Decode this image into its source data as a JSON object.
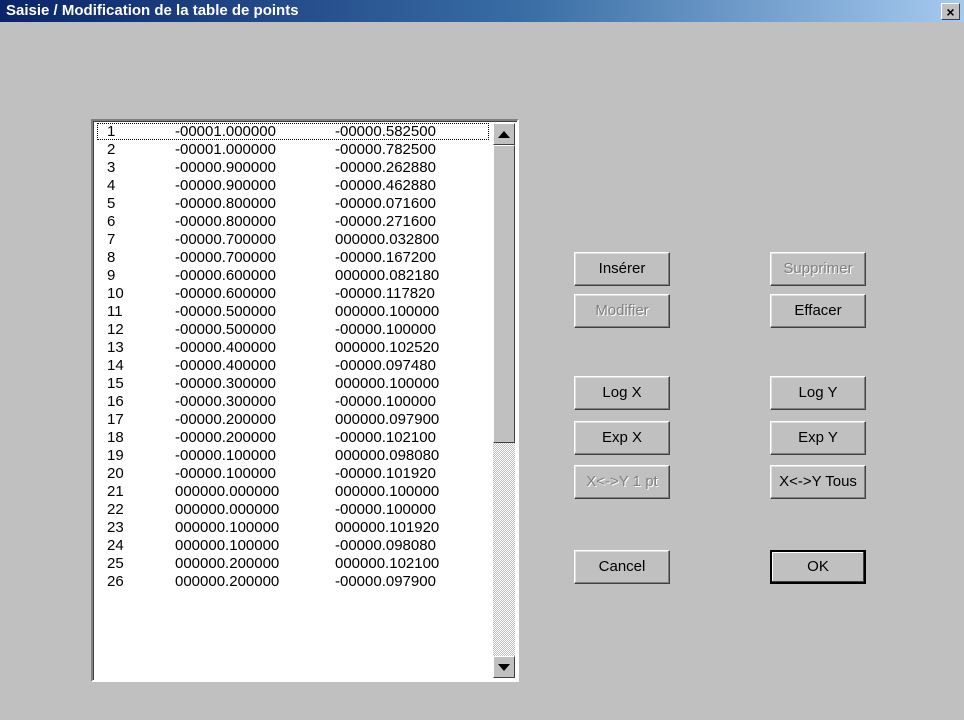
{
  "window": {
    "title": "Saisie / Modification de la table de points",
    "close_glyph": "×"
  },
  "table": {
    "rows": [
      {
        "idx": "1",
        "x": "-00001.000000",
        "y": "-00000.582500"
      },
      {
        "idx": "2",
        "x": "-00001.000000",
        "y": "-00000.782500"
      },
      {
        "idx": "3",
        "x": "-00000.900000",
        "y": "-00000.262880"
      },
      {
        "idx": "4",
        "x": "-00000.900000",
        "y": "-00000.462880"
      },
      {
        "idx": "5",
        "x": "-00000.800000",
        "y": "-00000.071600"
      },
      {
        "idx": "6",
        "x": "-00000.800000",
        "y": "-00000.271600"
      },
      {
        "idx": "7",
        "x": "-00000.700000",
        "y": "000000.032800"
      },
      {
        "idx": "8",
        "x": "-00000.700000",
        "y": "-00000.167200"
      },
      {
        "idx": "9",
        "x": "-00000.600000",
        "y": "000000.082180"
      },
      {
        "idx": "10",
        "x": "-00000.600000",
        "y": "-00000.117820"
      },
      {
        "idx": "11",
        "x": "-00000.500000",
        "y": "000000.100000"
      },
      {
        "idx": "12",
        "x": "-00000.500000",
        "y": "-00000.100000"
      },
      {
        "idx": "13",
        "x": "-00000.400000",
        "y": "000000.102520"
      },
      {
        "idx": "14",
        "x": "-00000.400000",
        "y": "-00000.097480"
      },
      {
        "idx": "15",
        "x": "-00000.300000",
        "y": "000000.100000"
      },
      {
        "idx": "16",
        "x": "-00000.300000",
        "y": "-00000.100000"
      },
      {
        "idx": "17",
        "x": "-00000.200000",
        "y": "000000.097900"
      },
      {
        "idx": "18",
        "x": "-00000.200000",
        "y": "-00000.102100"
      },
      {
        "idx": "19",
        "x": "-00000.100000",
        "y": "000000.098080"
      },
      {
        "idx": "20",
        "x": "-00000.100000",
        "y": "-00000.101920"
      },
      {
        "idx": "21",
        "x": "000000.000000",
        "y": "000000.100000"
      },
      {
        "idx": "22",
        "x": "000000.000000",
        "y": "-00000.100000"
      },
      {
        "idx": "23",
        "x": "000000.100000",
        "y": "000000.101920"
      },
      {
        "idx": "24",
        "x": "000000.100000",
        "y": "-00000.098080"
      },
      {
        "idx": "25",
        "x": "000000.200000",
        "y": "000000.102100"
      },
      {
        "idx": "26",
        "x": "000000.200000",
        "y": "-00000.097900"
      }
    ]
  },
  "buttons": {
    "inserer": "Insérer",
    "supprimer": "Supprimer",
    "modifier": "Modifier",
    "effacer": "Effacer",
    "logx": "Log X",
    "logy": "Log Y",
    "expx": "Exp X",
    "expy": "Exp Y",
    "swap_one": "X<->Y 1 pt",
    "swap_all": "X<->Y Tous",
    "cancel": "Cancel",
    "ok": "OK"
  },
  "colors": {
    "titlebar_start": "#0a246a",
    "titlebar_end": "#a6caf0",
    "face": "#c0c0c0",
    "disabled_text": "#808080"
  }
}
